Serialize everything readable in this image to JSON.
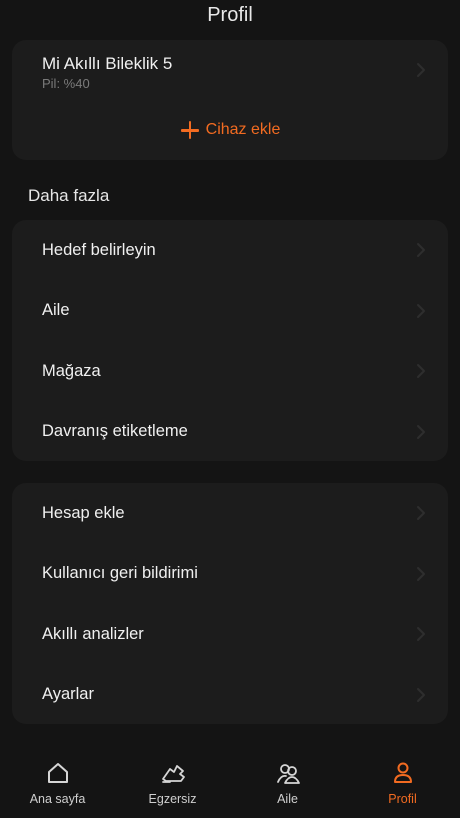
{
  "header": {
    "title": "Profil"
  },
  "device": {
    "name": "Mi Akıllı Bileklik 5",
    "battery": "Pil: %40",
    "add_label": "Cihaz ekle"
  },
  "more": {
    "title": "Daha fazla",
    "group1": [
      "Hedef belirleyin",
      "Aile",
      "Mağaza",
      "Davranış etiketleme"
    ],
    "group2": [
      "Hesap ekle",
      "Kullanıcı geri bildirimi",
      "Akıllı analizler",
      "Ayarlar"
    ]
  },
  "nav": {
    "items": [
      {
        "label": "Ana sayfa",
        "icon": "home-icon"
      },
      {
        "label": "Egzersiz",
        "icon": "shoe-icon"
      },
      {
        "label": "Aile",
        "icon": "family-icon"
      },
      {
        "label": "Profil",
        "icon": "profile-icon"
      }
    ],
    "active_index": 3
  },
  "colors": {
    "accent": "#f26b21",
    "background": "#141414",
    "card": "#1c1c1c"
  }
}
